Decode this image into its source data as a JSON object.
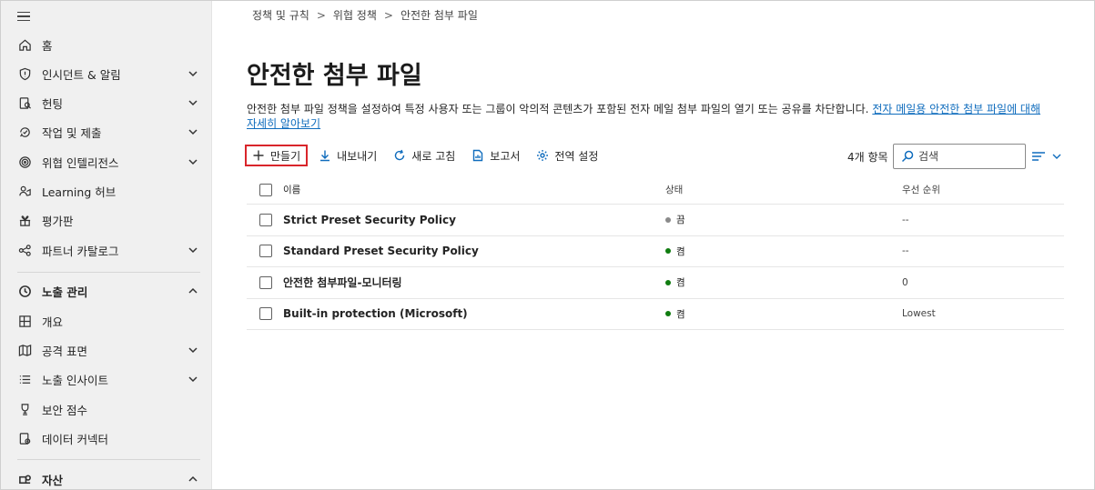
{
  "sidebar": {
    "items": [
      {
        "label": "홈",
        "icon": "home-icon"
      },
      {
        "label": "인시던트 & 알림",
        "icon": "shield-icon"
      },
      {
        "label": "헌팅",
        "icon": "hunting-icon"
      },
      {
        "label": "작업 및 제출",
        "icon": "actions-icon"
      },
      {
        "label": "위협 인텔리전스",
        "icon": "threat-intel-icon"
      },
      {
        "label": "Learning 허브",
        "icon": "learning-icon"
      },
      {
        "label": "평가판",
        "icon": "trial-icon"
      },
      {
        "label": "파트너 카탈로그",
        "icon": "partner-icon"
      },
      {
        "label": "노출 관리",
        "icon": "exposure-icon"
      },
      {
        "label": "개요",
        "icon": "overview-icon"
      },
      {
        "label": "공격 표면",
        "icon": "map-icon"
      },
      {
        "label": "노출 인사이트",
        "icon": "list-icon"
      },
      {
        "label": "보안 점수",
        "icon": "trophy-icon"
      },
      {
        "label": "데이터 커넥터",
        "icon": "connector-icon"
      },
      {
        "label": "자산",
        "icon": "assets-icon"
      }
    ]
  },
  "breadcrumb": {
    "items": [
      "정책 및 규칙",
      "위협 정책",
      "안전한 첨부 파일"
    ],
    "separator": ">"
  },
  "page": {
    "title": "안전한 첨부 파일",
    "description": "안전한 첨부 파일 정책을 설정하여 특정 사용자 또는 그룹이 악의적 콘텐츠가 포함된 전자 메일 첨부 파일의 열기 또는 공유를 차단합니다.",
    "link_line1": "전자 메일용 안전한 첨부 파일에 대해",
    "link_line2": "자세히 알아보기"
  },
  "toolbar": {
    "create": "만들기",
    "export": "내보내기",
    "refresh": "새로 고침",
    "report": "보고서",
    "global_settings": "전역 설정",
    "count": "4개 항목",
    "search_placeholder": "검색"
  },
  "table": {
    "headers": {
      "name": "이름",
      "status": "상태",
      "priority": "우선 순위"
    },
    "rows": [
      {
        "name": "Strict Preset Security Policy",
        "status": "끔",
        "status_color": "#8a8a8a",
        "priority": "--"
      },
      {
        "name": "Standard Preset Security Policy",
        "status": "켬",
        "status_color": "#107c10",
        "priority": "--"
      },
      {
        "name": "안전한 첨부파일-모니터링",
        "status": "켬",
        "status_color": "#107c10",
        "priority": "0"
      },
      {
        "name": "Built-in protection (Microsoft)",
        "status": "켬",
        "status_color": "#107c10",
        "priority": "Lowest"
      }
    ]
  },
  "colors": {
    "accent": "#0f6cbd",
    "highlight_border": "#d9252b",
    "sidebar_bg": "#f0f0f0"
  }
}
